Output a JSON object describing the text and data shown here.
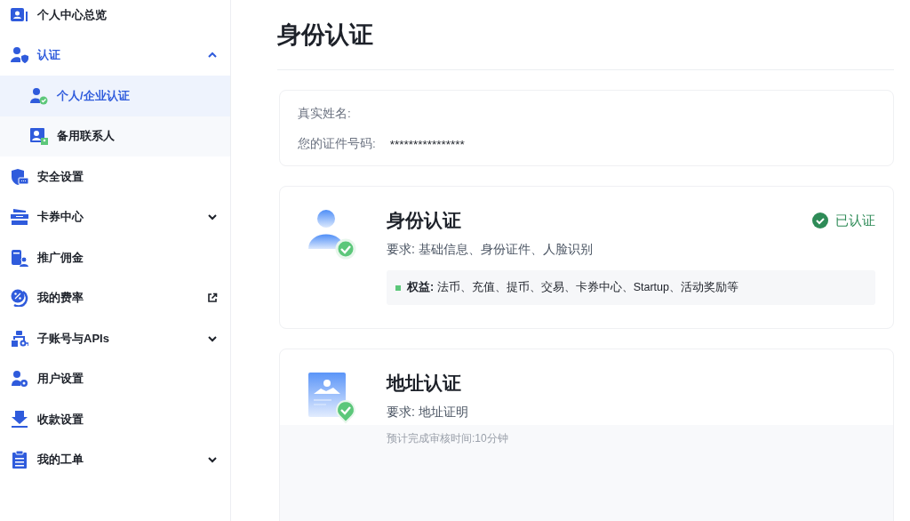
{
  "sidebar": {
    "items": [
      {
        "label": "个人中心总览",
        "kind": "plain",
        "selected": false
      },
      {
        "label": "认证",
        "kind": "expandable",
        "selected": false,
        "expanded": true,
        "children": [
          {
            "label": "个人/企业认证",
            "selected": true
          },
          {
            "label": "备用联系人",
            "selected": false
          }
        ]
      },
      {
        "label": "安全设置",
        "kind": "plain",
        "selected": false
      },
      {
        "label": "卡券中心",
        "kind": "expandable",
        "selected": false,
        "expanded": false
      },
      {
        "label": "推广佣金",
        "kind": "plain",
        "selected": false
      },
      {
        "label": "我的费率",
        "kind": "external",
        "selected": false
      },
      {
        "label": "子账号与APIs",
        "kind": "expandable",
        "selected": false,
        "expanded": false
      },
      {
        "label": "用户设置",
        "kind": "plain",
        "selected": false
      },
      {
        "label": "收款设置",
        "kind": "plain",
        "selected": false
      },
      {
        "label": "我的工单",
        "kind": "expandable",
        "selected": false,
        "expanded": false
      }
    ]
  },
  "page": {
    "title": "身份认证"
  },
  "info": [
    {
      "label": "真实姓名:"
    },
    {
      "label": "您的证件号码:",
      "value": "****************"
    }
  ],
  "verifications": [
    {
      "kind": "identity",
      "title": "身份认证",
      "requirement": "要求: 基础信息、身份证件、人脸识别",
      "verified": true,
      "status": "已认证",
      "benefits": "**权益:** 法币、充值、提币、交易、卡券中心、Startup、活动奖励等"
    },
    {
      "kind": "address",
      "title": "地址认证",
      "requirement": "要求: 地址证明",
      "verified": false,
      "eta": "预计完成审核时间:10分钟"
    }
  ]
}
